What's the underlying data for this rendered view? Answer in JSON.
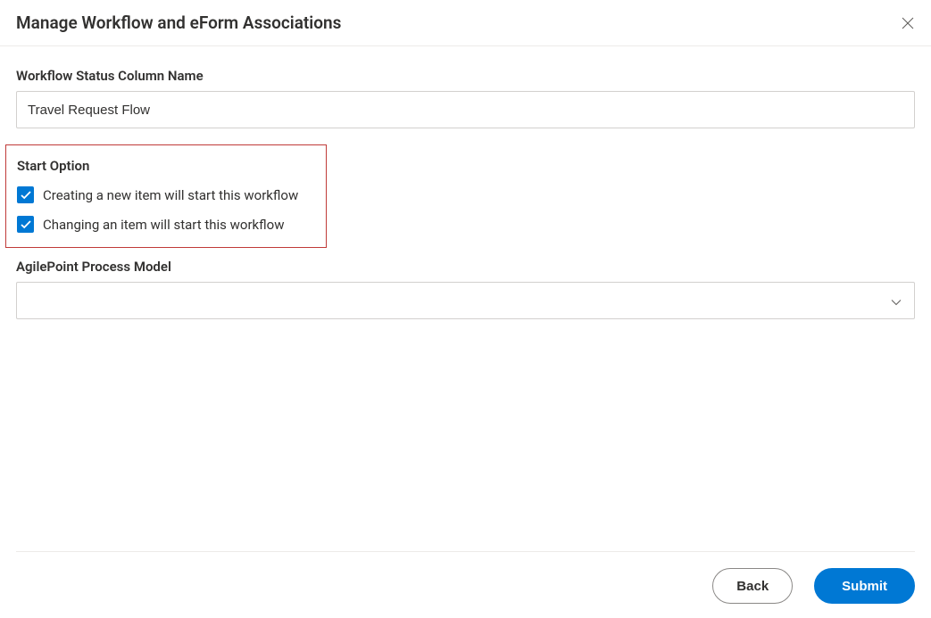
{
  "header": {
    "title": "Manage Workflow and eForm Associations"
  },
  "form": {
    "status_column": {
      "label": "Workflow Status Column Name",
      "value": "Travel Request Flow"
    },
    "start_option": {
      "label": "Start Option",
      "options": [
        {
          "label": "Creating a new item will start this workflow",
          "checked": true
        },
        {
          "label": "Changing an item will start this workflow",
          "checked": true
        }
      ]
    },
    "process_model": {
      "label": "AgilePoint Process Model",
      "value": ""
    }
  },
  "footer": {
    "back_label": "Back",
    "submit_label": "Submit"
  },
  "colors": {
    "accent": "#0078d4",
    "highlight_border": "#c03a38"
  }
}
